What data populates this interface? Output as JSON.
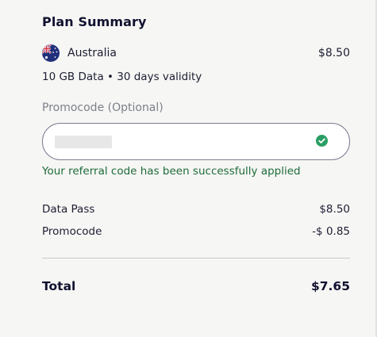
{
  "summary": {
    "title": "Plan Summary",
    "country": "Australia",
    "country_flag_icon": "australia-flag-icon",
    "plan_price": "$8.50",
    "plan_detail": "10 GB Data • 30 days validity"
  },
  "promo": {
    "label": "Promocode (Optional)",
    "value": "",
    "status_icon": "check-circle-icon",
    "status_color": "#2a9d63",
    "success_message": "Your referral code has been successfully applied"
  },
  "breakdown": {
    "data_pass_label": "Data Pass",
    "data_pass_amount": "$8.50",
    "promocode_label": "Promocode",
    "promocode_amount": "-$ 0.85"
  },
  "total": {
    "label": "Total",
    "amount": "$7.65"
  },
  "colors": {
    "background": "#f6f6f4",
    "text": "#14152b",
    "success": "#1e6b3a",
    "muted": "#7d8089"
  }
}
